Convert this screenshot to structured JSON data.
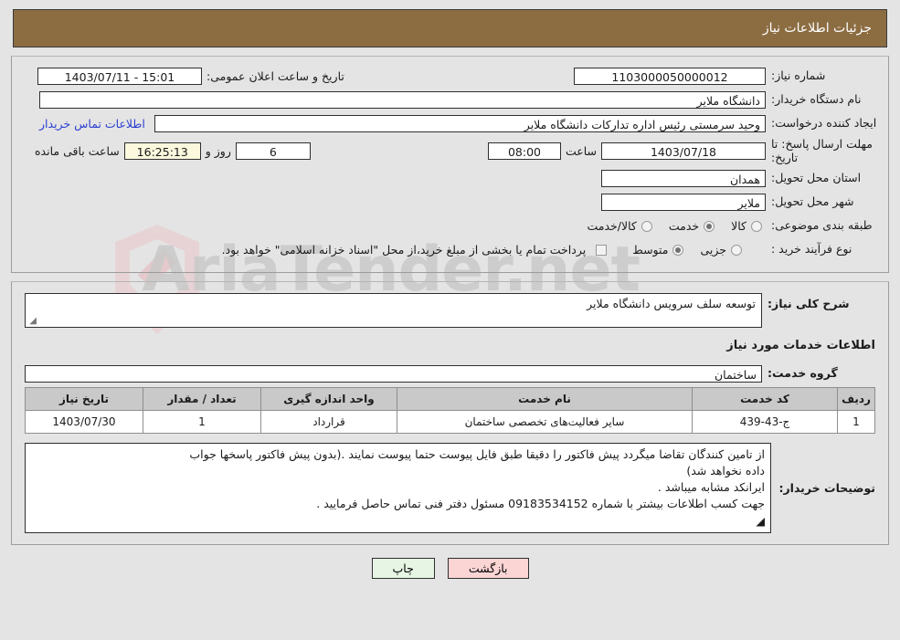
{
  "header": {
    "title": "جزئیات اطلاعات نیاز"
  },
  "watermark": {
    "text": "AriaTender.net"
  },
  "need_info": {
    "need_number_label": "شماره نیاز:",
    "need_number_value": "1103000050000012",
    "announce_label": "تاریخ و ساعت اعلان عمومی:",
    "announce_value": "15:01 - 1403/07/11",
    "buyer_org_label": "نام دستگاه خریدار:",
    "buyer_org_value": "دانشگاه ملایر",
    "creator_label": "ایجاد کننده درخواست:",
    "creator_value": "وحید سرمستی رئیس اداره تدارکات دانشگاه ملایر",
    "contact_link": "اطلاعات تماس خریدار",
    "deadline_label": "مهلت ارسال پاسخ: تا تاریخ:",
    "deadline_date": "1403/07/18",
    "hour_label": "ساعت",
    "deadline_time": "08:00",
    "days_value": "6",
    "days_unit": "روز و",
    "countdown_value": "16:25:13",
    "countdown_unit": "ساعت باقی مانده",
    "province_label": "استان محل تحویل:",
    "province_value": "همدان",
    "city_label": "شهر محل تحویل:",
    "city_value": "ملایر",
    "category_label": "طبقه بندی موضوعی:",
    "category_options": [
      {
        "label": "کالا",
        "selected": false
      },
      {
        "label": "خدمت",
        "selected": true
      },
      {
        "label": "کالا/خدمت",
        "selected": false
      }
    ],
    "process_label": "نوع فرآیند خرید :",
    "process_options": [
      {
        "label": "جزیی",
        "selected": false
      },
      {
        "label": "متوسط",
        "selected": true
      }
    ],
    "treasury_checkbox_label": "پرداخت تمام یا بخشی از مبلغ خرید،از محل \"اسناد خزانه اسلامی\" خواهد بود.",
    "treasury_checked": false
  },
  "details": {
    "general_desc_label": "شرح کلی نیاز:",
    "general_desc_value": "توسعه سلف سرویس دانشگاه ملایر",
    "services_section_title": "اطلاعات خدمات مورد نیاز",
    "service_group_label": "گروه خدمت:",
    "service_group_value": "ساختمان",
    "table": {
      "columns": [
        "ردیف",
        "کد خدمت",
        "نام خدمت",
        "واحد اندازه گیری",
        "تعداد / مقدار",
        "تاریخ نیاز"
      ],
      "rows": [
        {
          "row": "1",
          "code": "ج-43-439",
          "name": "سایر فعالیت‌های تخصصی ساختمان",
          "unit": "قرارداد",
          "qty": "1",
          "date": "1403/07/30"
        }
      ]
    },
    "notes_label": "توضیحات خریدار:",
    "notes_lines": [
      "از تامین کنندگان تقاضا میگردد پیش فاکتور را دقیقا طبق فایل پیوست حتما پیوست نمایند .(بدون پیش فاکتور پاسخها جواب",
      "داده نخواهد شد)",
      "ایرانکد مشابه میباشد .",
      "جهت کسب اطلاعات بیشتر با شماره  09183534152  مسئول دفتر فنی تماس حاصل فرمایید ."
    ]
  },
  "footer": {
    "print_label": "چاپ",
    "back_label": "بازگشت"
  }
}
